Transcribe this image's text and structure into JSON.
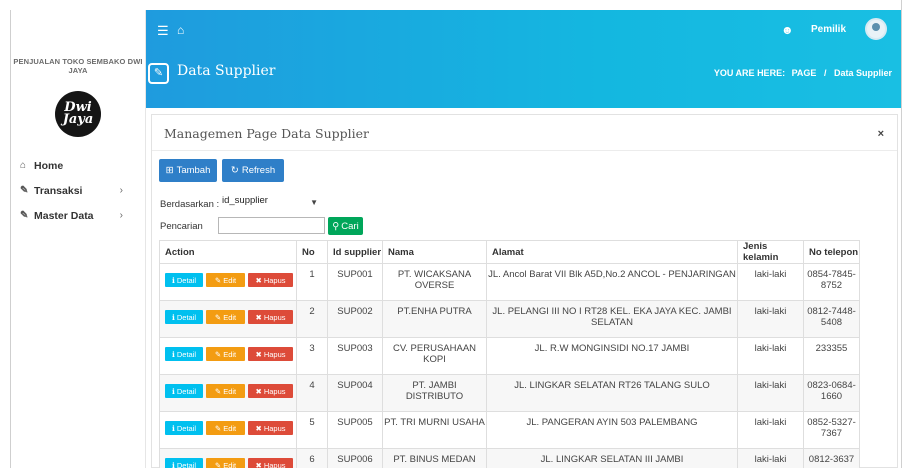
{
  "sidebar": {
    "brand": "PENJUALAN TOKO SEMBAKO DWI JAYA",
    "logo_text": "Dwi Jaya",
    "menu": [
      {
        "label": "Home",
        "icon": "home-icon",
        "has_children": false
      },
      {
        "label": "Transaksi",
        "icon": "pencil-icon",
        "has_children": true
      },
      {
        "label": "Master Data",
        "icon": "edit-icon",
        "has_children": true
      }
    ]
  },
  "header": {
    "user": "Pemilik",
    "page_title": "Data Supplier",
    "breadcrumb_label": "YOU ARE HERE:",
    "breadcrumb_page": "PAGE",
    "breadcrumb_sep": "/",
    "breadcrumb_current": "Data Supplier"
  },
  "card": {
    "title": "Managemen Page Data Supplier",
    "close_label": "×",
    "btn_tambah": "Tambah",
    "btn_refresh": "Refresh",
    "berdasarkan_label": "Berdasarkan :",
    "berdasarkan_value": "id_supplier",
    "pencarian_label": "Pencarian",
    "pencarian_colon": ":",
    "search_value": "",
    "btn_cari": "Cari"
  },
  "table": {
    "headers": [
      "Action",
      "No",
      "Id supplier",
      "Nama",
      "Alamat",
      "Jenis kelamin",
      "No telepon"
    ],
    "action_labels": {
      "detail": "Detail",
      "edit": "Edit",
      "hapus": "Hapus"
    },
    "rows": [
      {
        "no": "1",
        "id": "SUP001",
        "nama": "PT. WICAKSANA OVERSE",
        "alamat": "JL. Ancol Barat VII Blk A5D,No.2 ANCOL - PENJARINGAN",
        "jk": "laki-laki",
        "telp": "0854-7845-8752"
      },
      {
        "no": "2",
        "id": "SUP002",
        "nama": "PT.ENHA PUTRA",
        "alamat": "JL. PELANGI III NO I RT28 KEL. EKA JAYA KEC. JAMBI SELATAN",
        "jk": "laki-laki",
        "telp": "0812-7448-5408"
      },
      {
        "no": "3",
        "id": "SUP003",
        "nama": "CV. PERUSAHAAN KOPI",
        "alamat": "JL. R.W MONGINSIDI NO.17 JAMBI",
        "jk": "laki-laki",
        "telp": "233355"
      },
      {
        "no": "4",
        "id": "SUP004",
        "nama": "PT. JAMBI DISTRIBUTO",
        "alamat": "JL. LINGKAR SELATAN RT26 TALANG SULO",
        "jk": "laki-laki",
        "telp": "0823-0684-1660"
      },
      {
        "no": "5",
        "id": "SUP005",
        "nama": "PT. TRI MURNI USAHA",
        "alamat": "JL. PANGERAN AYIN 503 PALEMBANG",
        "jk": "laki-laki",
        "telp": "0852-5327-7367"
      },
      {
        "no": "6",
        "id": "SUP006",
        "nama": "PT. BINUS MEDAN",
        "alamat": "JL. LINGKAR SELATAN III JAMBI",
        "jk": "laki-laki",
        "telp": "0812-3637"
      }
    ]
  }
}
